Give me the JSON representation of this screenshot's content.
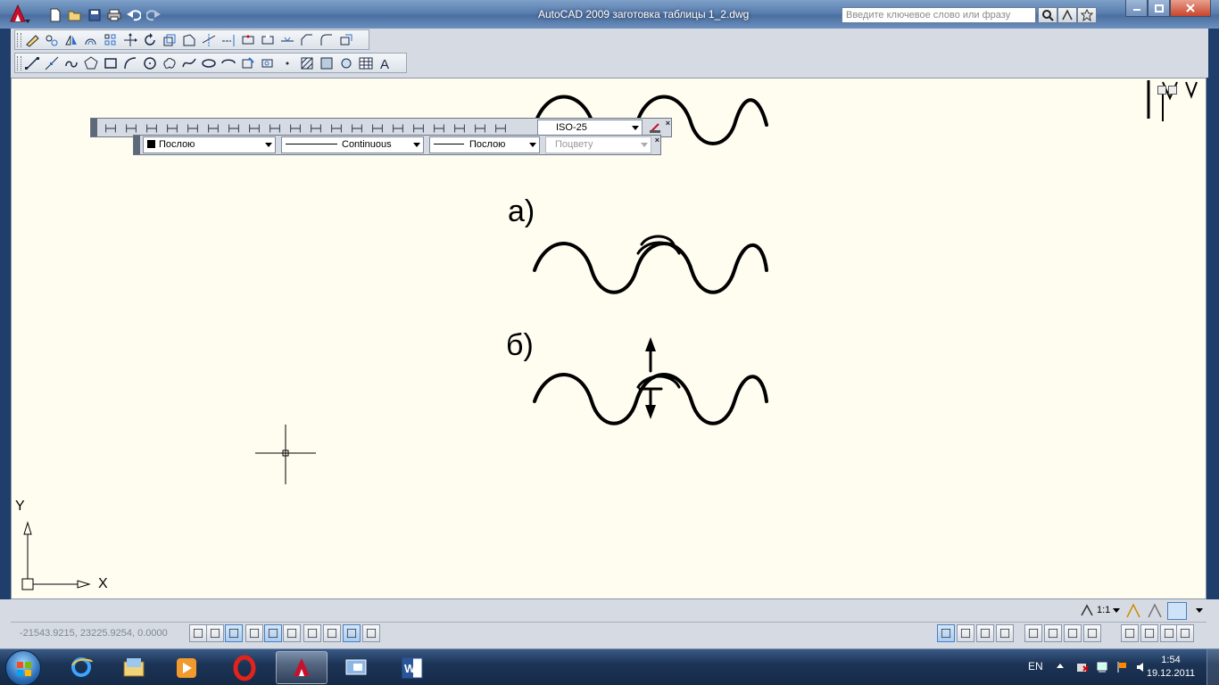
{
  "window": {
    "title": "AutoCAD 2009 заготовка таблицы 1_2.dwg",
    "search_placeholder": "Введите ключевое слово или фразу",
    "controls": [
      "minimize-icon",
      "maximize-icon",
      "close-icon"
    ]
  },
  "quick_access": [
    "new-icon",
    "open-icon",
    "save-icon",
    "print-icon",
    "undo-icon",
    "redo-icon"
  ],
  "toolbar_modify": [
    "erase-icon",
    "copy-icon",
    "mirror-icon",
    "offset-icon",
    "array-icon",
    "move-icon",
    "rotate-icon",
    "scale-icon",
    "stretch-icon",
    "trim-icon",
    "extend-icon",
    "break-at-point-icon",
    "break-icon",
    "join-icon",
    "chamfer-icon",
    "fillet-icon",
    "explode-icon"
  ],
  "toolbar_draw": [
    "line-icon",
    "construction-line-icon",
    "polyline-icon",
    "polygon-icon",
    "rectangle-icon",
    "arc-icon",
    "circle-icon",
    "revision-cloud-icon",
    "spline-icon",
    "ellipse-icon",
    "ellipse-arc-icon",
    "insert-block-icon",
    "make-block-icon",
    "point-icon",
    "hatch-icon",
    "gradient-icon",
    "region-icon",
    "table-icon",
    "multiline-text-icon"
  ],
  "dim_toolbar": {
    "dimstyle": "ISO-25"
  },
  "properties_toolbar": {
    "color": "Послою",
    "linetype": "Continuous",
    "lineweight": "Послою",
    "plotstyle": "Поцвету"
  },
  "drawing": {
    "label_a": "а)",
    "label_b": "б)"
  },
  "ucs": {
    "x_label": "X",
    "y_label": "Y"
  },
  "status": {
    "coords": "-21543.9215, 23225.9254, 0.0000",
    "annotation_scale": "1:1"
  },
  "taskbar": {
    "apps": [
      "internet-explorer-icon",
      "explorer-icon",
      "media-player-icon",
      "opera-icon",
      "autocad-icon",
      "remote-desktop-icon",
      "word-icon"
    ],
    "lang": "EN",
    "time": "1:54",
    "date": "19.12.2011"
  },
  "colors": {
    "canvas_bg": "#fffdf0",
    "toolbar_bg": "#d6dbe3",
    "taskbar_bg": "#1c3456"
  }
}
